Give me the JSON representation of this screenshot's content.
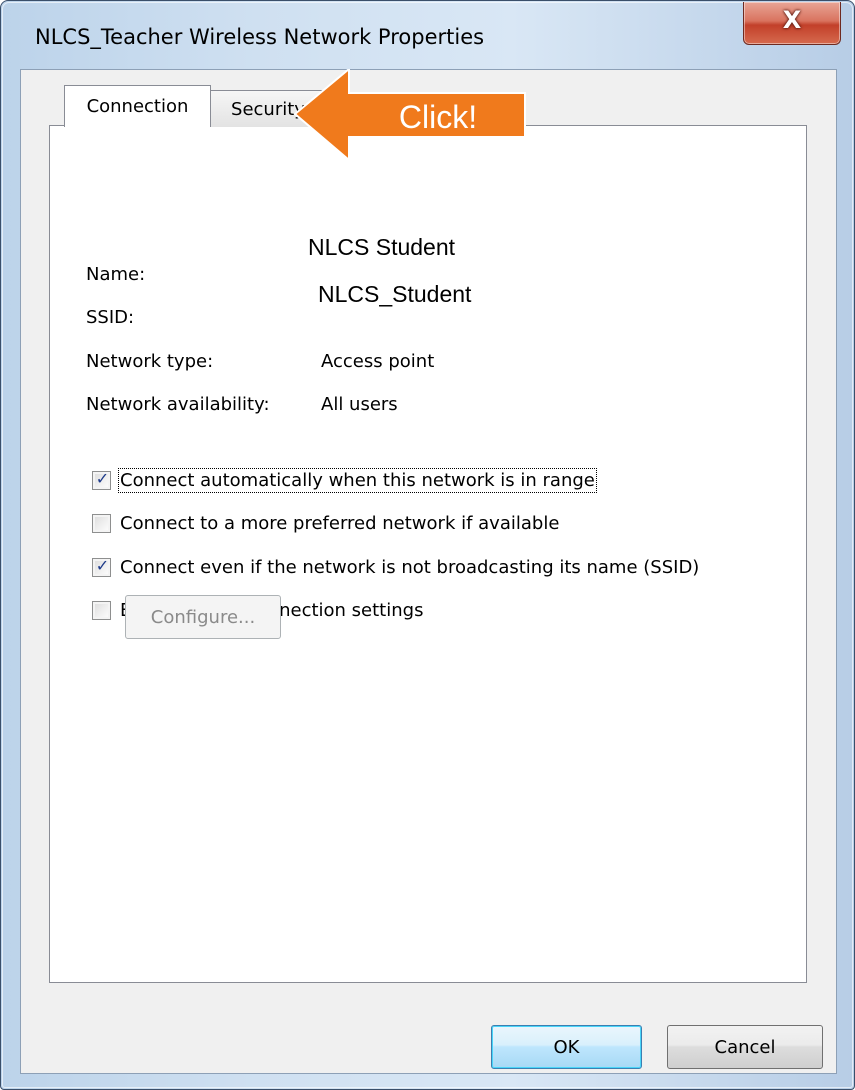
{
  "window": {
    "title": "NLCS_Teacher Wireless Network Properties",
    "close_label": "X"
  },
  "tabs": [
    {
      "label": "Connection",
      "active": true
    },
    {
      "label": "Security",
      "active": false
    }
  ],
  "callout": {
    "text": "Click!",
    "color": "#f07a1c"
  },
  "fields": [
    {
      "label": "Name:",
      "value": "NLCS  Student"
    },
    {
      "label": "SSID:",
      "value": "NLCS_Student"
    },
    {
      "label": "Network type:",
      "value": "Access point"
    },
    {
      "label": "Network availability:",
      "value": "All users"
    }
  ],
  "checkboxes": [
    {
      "label": "Connect automatically when this network is in range",
      "checked": true
    },
    {
      "label": "Connect to a more preferred network if available",
      "checked": false
    },
    {
      "label": "Connect even if the network is not broadcasting its name (SSID)",
      "checked": true
    },
    {
      "label": "Enable WLAN connection settings",
      "checked": false
    }
  ],
  "configure_label": "Configure...",
  "buttons": {
    "ok": "OK",
    "cancel": "Cancel"
  },
  "colors": {
    "accent_ok": "#bee6fd",
    "checkmark": "#1e3b8a"
  }
}
